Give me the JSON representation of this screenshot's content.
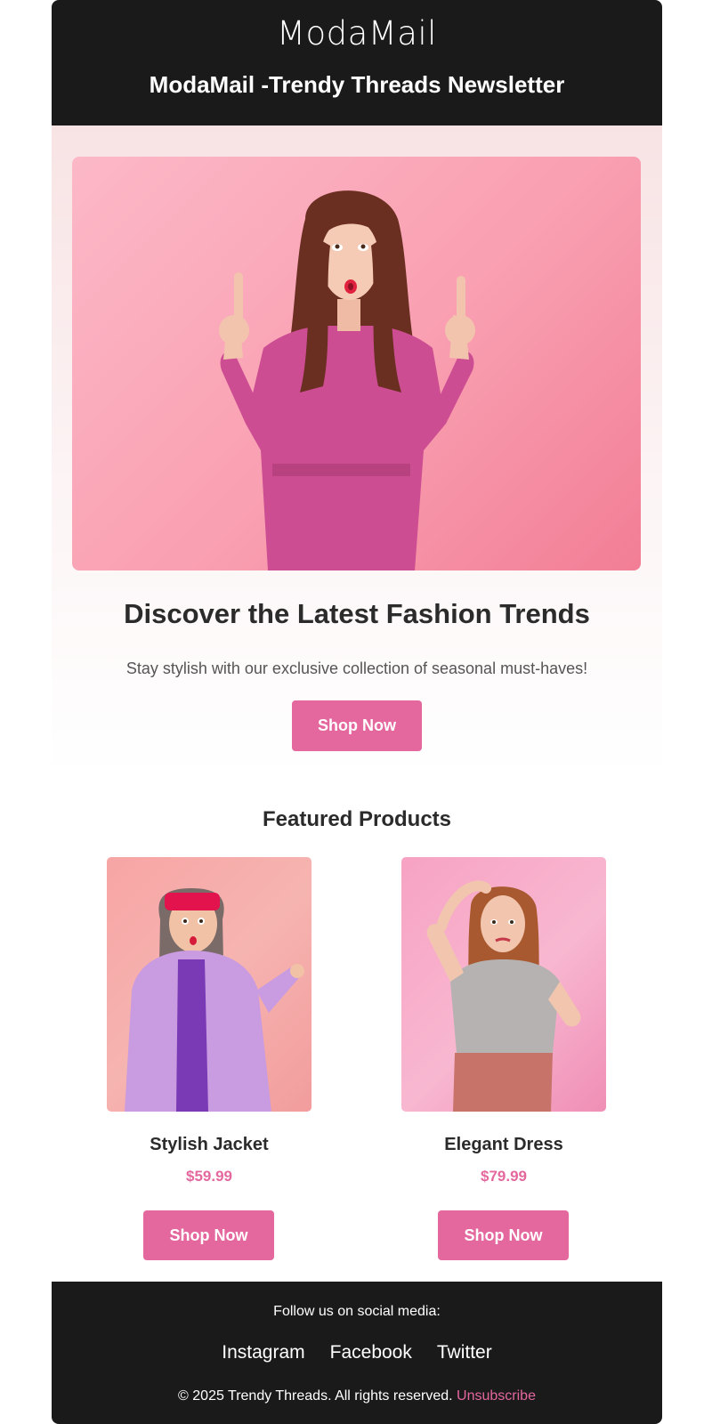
{
  "header": {
    "logo": "ModaMail",
    "title": "ModaMail -Trendy Threads Newsletter"
  },
  "hero": {
    "heading": "Discover the Latest Fashion Trends",
    "subheading": "Stay stylish with our exclusive collection of seasonal must-haves!",
    "button_label": "Shop Now"
  },
  "featured": {
    "title": "Featured Products",
    "products": [
      {
        "name": "Stylish Jacket",
        "price": "$59.99",
        "button_label": "Shop Now"
      },
      {
        "name": "Elegant Dress",
        "price": "$79.99",
        "button_label": "Shop Now"
      }
    ]
  },
  "footer": {
    "follow_text": "Follow us on social media:",
    "social_links": [
      "Instagram",
      "Facebook",
      "Twitter"
    ],
    "copyright": "© 2025 Trendy Threads. All rights reserved.",
    "unsubscribe": "Unsubscribe"
  },
  "colors": {
    "header_bg": "#1b1a1b",
    "accent": "#e4679e",
    "text_dark": "#2b2b2b"
  }
}
